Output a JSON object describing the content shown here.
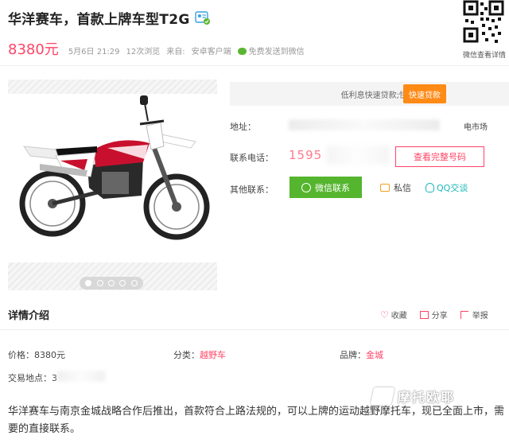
{
  "listing": {
    "title": "华洋赛车，首款上牌车型T2G",
    "price": "8380元",
    "date": "5月6日 21:29",
    "views": "12次浏览",
    "source_label": "来自:",
    "source": "安卓客户端",
    "send_to_wechat": "免费发送到微信"
  },
  "qr": {
    "caption": "微信查看详情"
  },
  "loan": {
    "text": "低利息快速贷款;快速！靠谱！",
    "button": "快速贷款"
  },
  "contact": {
    "address_label": "地址：",
    "address_value": "电市场",
    "phone_label": "联系电话：",
    "phone_value": "1595",
    "view_number_button": "查看完整号码",
    "other_label": "其他联系：",
    "wechat_button": "微信联系",
    "private_msg": "私信",
    "qq": "QQ交谈"
  },
  "gallery": {
    "dots": 5,
    "active_index": 0
  },
  "details": {
    "heading": "详情介绍",
    "actions": {
      "favorite": "收藏",
      "share": "分享",
      "report": "举报"
    },
    "price_label": "价格：",
    "price_value": "8380元",
    "category_label": "分类：",
    "category_value": "越野车",
    "brand_label": "品牌：",
    "brand_value": "金城",
    "location_label": "交易地点：",
    "location_value": "3",
    "description": "华洋赛车与南京金城战略合作后推出，首款符合上路法规的，可以上牌的运动越野摩托车，现已全面上市，需要的直接联系。"
  },
  "watermark": {
    "text": "摩托欧耶"
  },
  "colors": {
    "accent": "#ff4466",
    "wechat_green": "#55b52e",
    "loan_orange": "#ff8a16",
    "qq_teal": "#1cb8b8"
  }
}
